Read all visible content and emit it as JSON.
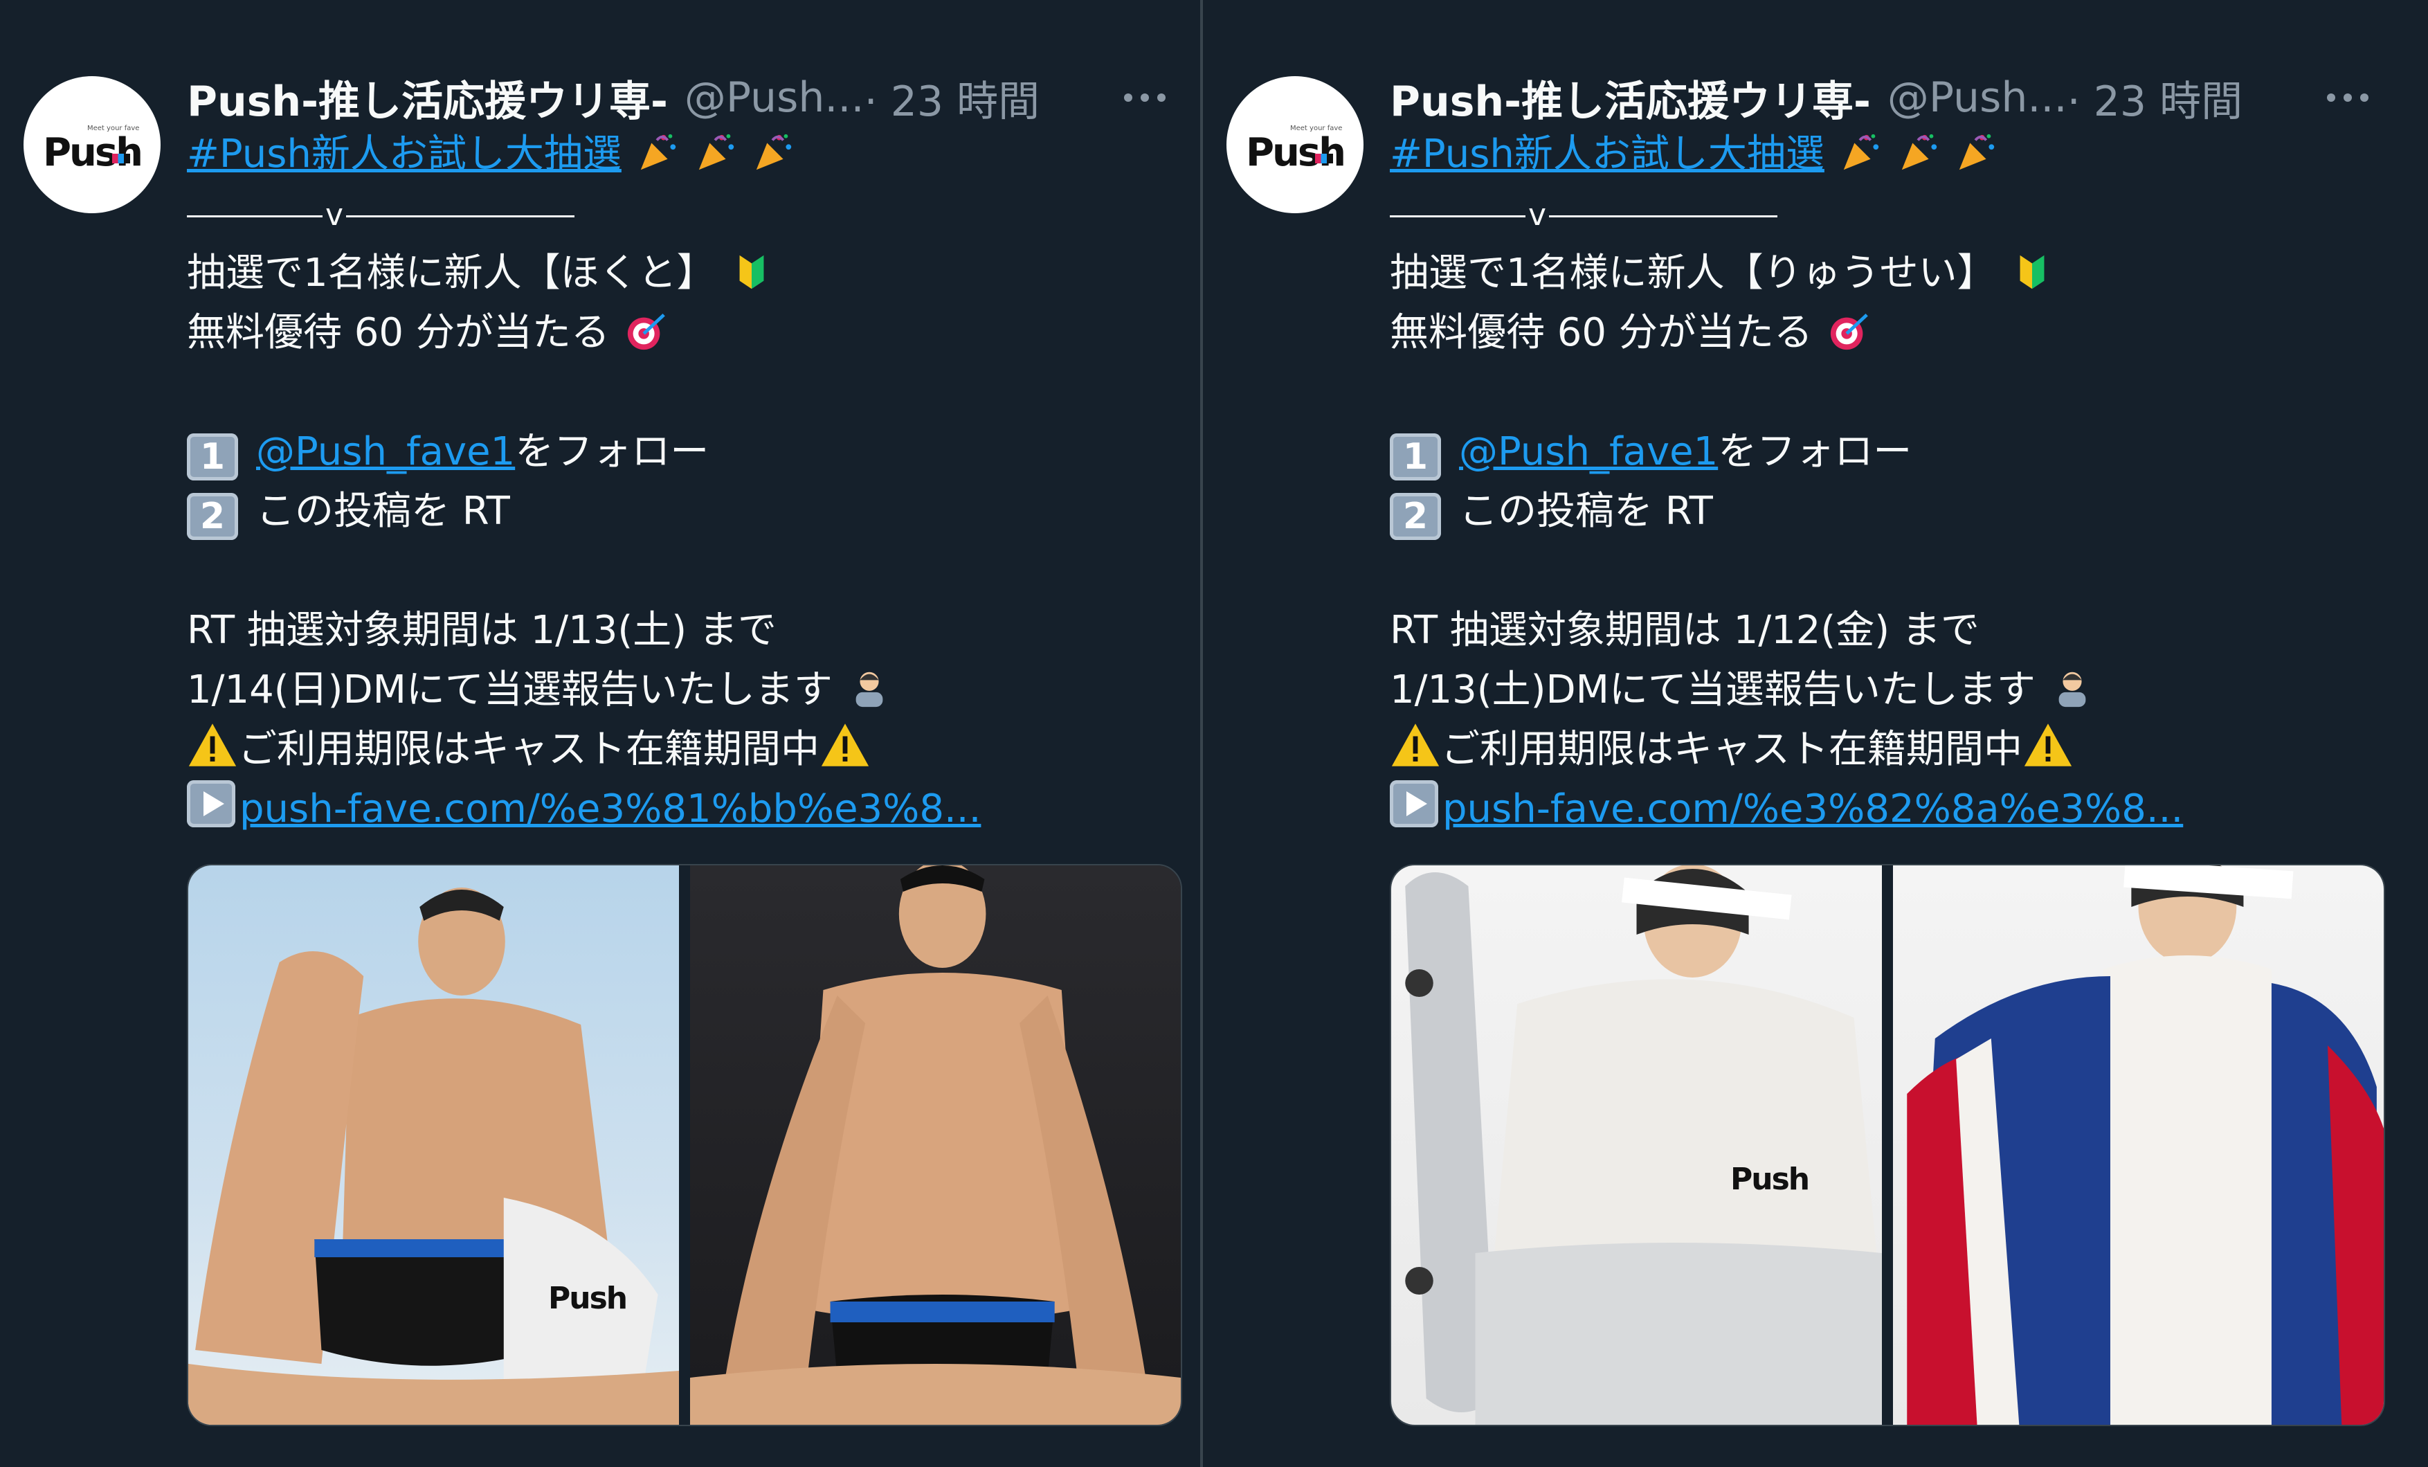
{
  "tweets": [
    {
      "name": "Push-推し活応援ウリ専-",
      "handle": "@Push...",
      "time": "· 23 時間",
      "avatar_logo": "Push",
      "hashtag": "#Push新人お試し大抽選",
      "separator_mark": "v",
      "line1": "抽選で1名様に新人【ほくと】",
      "line2": "無料優待 60 分が当たる",
      "step1_num": "1",
      "step1_mention": "@Push_fave1",
      "step1_text": "をフォロー",
      "step2_num": "2",
      "step2_text": "この投稿を RT",
      "period": "RT 抽選対象期間は 1/13(土) まで",
      "report": "1/14(日)DMにて当選報告いたします",
      "notice": "ご利用期限はキャスト在籍期間中",
      "link": "push-fave.com/%e3%81%bb%e3%8...",
      "photo_watermark": "Push"
    },
    {
      "name": "Push-推し活応援ウリ専-",
      "handle": "@Push...",
      "time": "· 23 時間",
      "avatar_logo": "Push",
      "hashtag": "#Push新人お試し大抽選",
      "separator_mark": "v",
      "line1": "抽選で1名様に新人【りゅうせい】",
      "line2": "無料優待 60 分が当たる",
      "step1_num": "1",
      "step1_mention": "@Push_fave1",
      "step1_text": "をフォロー",
      "step2_num": "2",
      "step2_text": "この投稿を RT",
      "period": "RT 抽選対象期間は 1/12(金) まで",
      "report": "1/13(土)DMにて当選報告いたします",
      "notice": "ご利用期限はキャスト在籍期間中",
      "link": "push-fave.com/%e3%82%8a%e3%8...",
      "photo_watermark": "Push"
    }
  ],
  "colors": {
    "background": "#15202b",
    "text": "#f7f9f9",
    "secondary": "#8b98a5",
    "link": "#1d9bf0"
  },
  "icons": [
    "party-popper-icon",
    "beginner-mark-icon",
    "target-icon",
    "keycap-icon",
    "person-bowing-icon",
    "warning-icon",
    "play-button-icon",
    "more-icon"
  ]
}
